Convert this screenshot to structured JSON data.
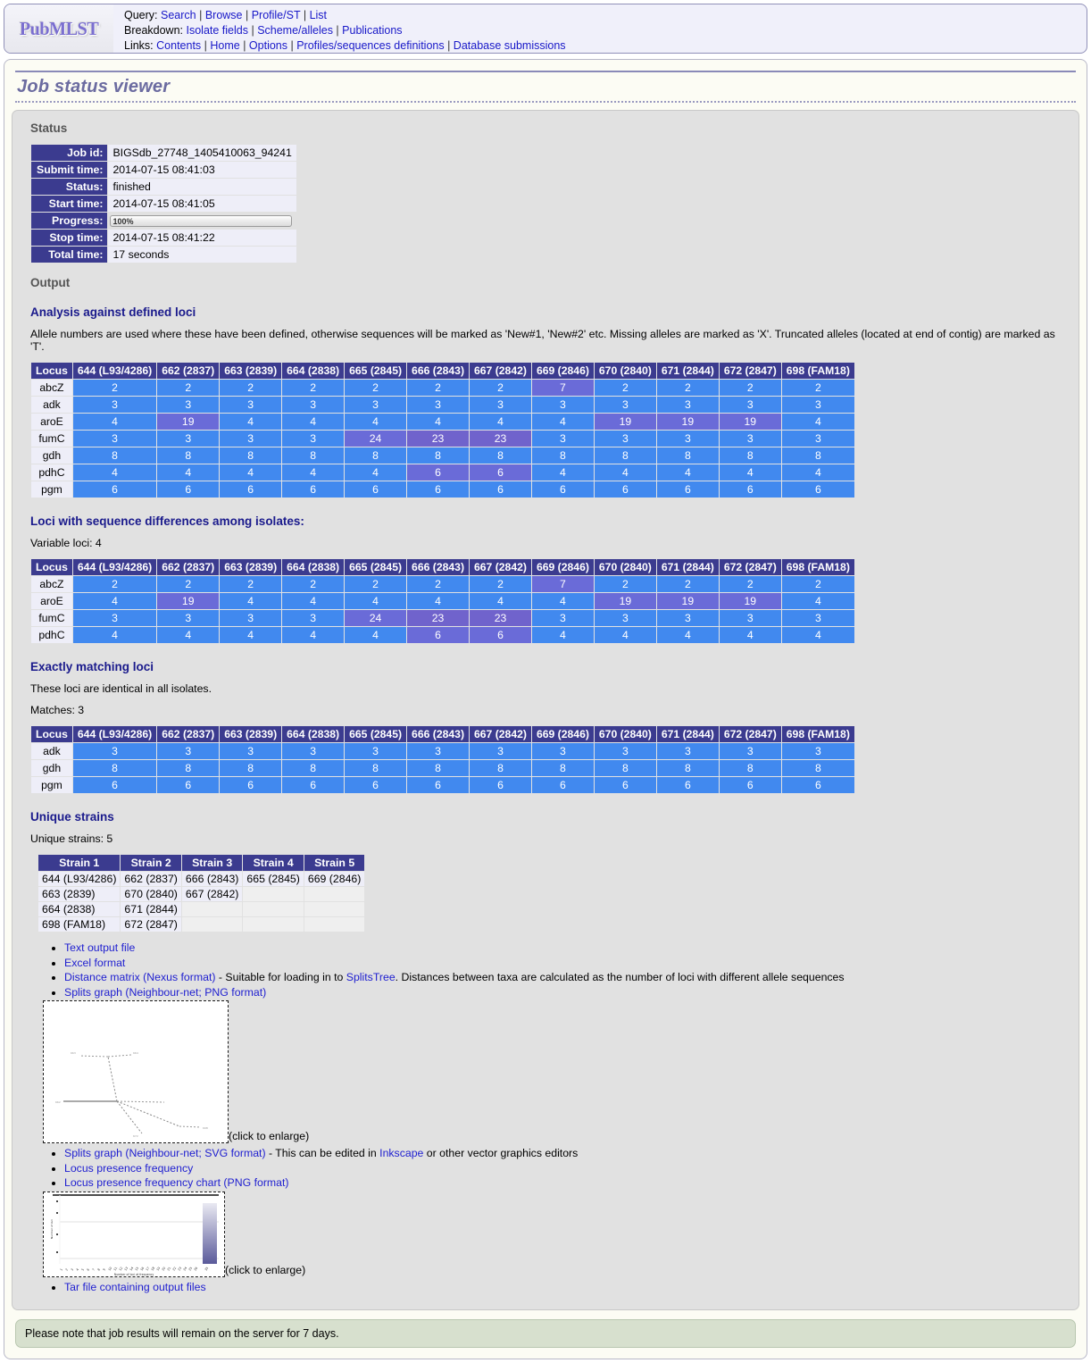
{
  "site": {
    "logo_text": "PubMLST"
  },
  "nav": {
    "rows": [
      {
        "label": "Query:",
        "links": [
          "Search",
          "Browse",
          "Profile/ST",
          "List"
        ]
      },
      {
        "label": "Breakdown:",
        "links": [
          "Isolate fields",
          "Scheme/alleles",
          "Publications"
        ]
      },
      {
        "label": "Links:",
        "links": [
          "Contents",
          "Home",
          "Options",
          "Profiles/sequences definitions",
          "Database submissions"
        ]
      }
    ]
  },
  "page": {
    "title": "Job status viewer"
  },
  "status": {
    "heading": "Status",
    "rows": [
      {
        "label": "Job id:",
        "value": "BIGSdb_27748_1405410063_94241"
      },
      {
        "label": "Submit time:",
        "value": "2014-07-15 08:41:03"
      },
      {
        "label": "Status:",
        "value": "finished"
      },
      {
        "label": "Start time:",
        "value": "2014-07-15 08:41:05"
      },
      {
        "label": "Progress:",
        "value": "100%"
      },
      {
        "label": "Stop time:",
        "value": "2014-07-15 08:41:22"
      },
      {
        "label": "Total time:",
        "value": "17 seconds"
      }
    ],
    "progress_percent": "100%"
  },
  "output": {
    "heading": "Output",
    "defined_loci": {
      "heading": "Analysis against defined loci",
      "description": "Allele numbers are used where these have been defined, otherwise sequences will be marked as 'New#1, 'New#2' etc. Missing alleles are marked as 'X'. Truncated alleles (located at end of contig) are marked as 'T'.",
      "columns": [
        "Locus",
        "644 (L93/4286)",
        "662 (2837)",
        "663 (2839)",
        "664 (2838)",
        "665 (2845)",
        "666 (2843)",
        "667 (2842)",
        "669 (2846)",
        "670 (2840)",
        "671 (2844)",
        "672 (2847)",
        "698 (FAM18)"
      ],
      "rows": [
        {
          "locus": "abcZ",
          "values": [
            "2",
            "2",
            "2",
            "2",
            "2",
            "2",
            "2",
            "7",
            "2",
            "2",
            "2",
            "2"
          ],
          "shades": [
            0,
            0,
            0,
            0,
            0,
            0,
            0,
            1,
            0,
            0,
            0,
            0
          ]
        },
        {
          "locus": "adk",
          "values": [
            "3",
            "3",
            "3",
            "3",
            "3",
            "3",
            "3",
            "3",
            "3",
            "3",
            "3",
            "3"
          ],
          "shades": [
            0,
            0,
            0,
            0,
            0,
            0,
            0,
            0,
            0,
            0,
            0,
            0
          ]
        },
        {
          "locus": "aroE",
          "values": [
            "4",
            "19",
            "4",
            "4",
            "4",
            "4",
            "4",
            "4",
            "19",
            "19",
            "19",
            "4"
          ],
          "shades": [
            0,
            1,
            0,
            0,
            0,
            0,
            0,
            0,
            1,
            1,
            1,
            0
          ]
        },
        {
          "locus": "fumC",
          "values": [
            "3",
            "3",
            "3",
            "3",
            "24",
            "23",
            "23",
            "3",
            "3",
            "3",
            "3",
            "3"
          ],
          "shades": [
            0,
            0,
            0,
            0,
            1,
            2,
            2,
            0,
            0,
            0,
            0,
            0
          ]
        },
        {
          "locus": "gdh",
          "values": [
            "8",
            "8",
            "8",
            "8",
            "8",
            "8",
            "8",
            "8",
            "8",
            "8",
            "8",
            "8"
          ],
          "shades": [
            0,
            0,
            0,
            0,
            0,
            0,
            0,
            0,
            0,
            0,
            0,
            0
          ]
        },
        {
          "locus": "pdhC",
          "values": [
            "4",
            "4",
            "4",
            "4",
            "4",
            "6",
            "6",
            "4",
            "4",
            "4",
            "4",
            "4"
          ],
          "shades": [
            0,
            0,
            0,
            0,
            0,
            1,
            1,
            0,
            0,
            0,
            0,
            0
          ]
        },
        {
          "locus": "pgm",
          "values": [
            "6",
            "6",
            "6",
            "6",
            "6",
            "6",
            "6",
            "6",
            "6",
            "6",
            "6",
            "6"
          ],
          "shades": [
            0,
            0,
            0,
            0,
            0,
            0,
            0,
            0,
            0,
            0,
            0,
            0
          ]
        }
      ]
    },
    "variable_loci": {
      "heading": "Loci with sequence differences among isolates:",
      "count_text": "Variable loci: 4",
      "columns": [
        "Locus",
        "644 (L93/4286)",
        "662 (2837)",
        "663 (2839)",
        "664 (2838)",
        "665 (2845)",
        "666 (2843)",
        "667 (2842)",
        "669 (2846)",
        "670 (2840)",
        "671 (2844)",
        "672 (2847)",
        "698 (FAM18)"
      ],
      "rows": [
        {
          "locus": "abcZ",
          "values": [
            "2",
            "2",
            "2",
            "2",
            "2",
            "2",
            "2",
            "7",
            "2",
            "2",
            "2",
            "2"
          ],
          "shades": [
            0,
            0,
            0,
            0,
            0,
            0,
            0,
            1,
            0,
            0,
            0,
            0
          ]
        },
        {
          "locus": "aroE",
          "values": [
            "4",
            "19",
            "4",
            "4",
            "4",
            "4",
            "4",
            "4",
            "19",
            "19",
            "19",
            "4"
          ],
          "shades": [
            0,
            1,
            0,
            0,
            0,
            0,
            0,
            0,
            1,
            1,
            1,
            0
          ]
        },
        {
          "locus": "fumC",
          "values": [
            "3",
            "3",
            "3",
            "3",
            "24",
            "23",
            "23",
            "3",
            "3",
            "3",
            "3",
            "3"
          ],
          "shades": [
            0,
            0,
            0,
            0,
            1,
            2,
            2,
            0,
            0,
            0,
            0,
            0
          ]
        },
        {
          "locus": "pdhC",
          "values": [
            "4",
            "4",
            "4",
            "4",
            "4",
            "6",
            "6",
            "4",
            "4",
            "4",
            "4",
            "4"
          ],
          "shades": [
            0,
            0,
            0,
            0,
            0,
            1,
            1,
            0,
            0,
            0,
            0,
            0
          ]
        }
      ]
    },
    "matching_loci": {
      "heading": "Exactly matching loci",
      "description": "These loci are identical in all isolates.",
      "count_text": "Matches: 3",
      "columns": [
        "Locus",
        "644 (L93/4286)",
        "662 (2837)",
        "663 (2839)",
        "664 (2838)",
        "665 (2845)",
        "666 (2843)",
        "667 (2842)",
        "669 (2846)",
        "670 (2840)",
        "671 (2844)",
        "672 (2847)",
        "698 (FAM18)"
      ],
      "rows": [
        {
          "locus": "adk",
          "values": [
            "3",
            "3",
            "3",
            "3",
            "3",
            "3",
            "3",
            "3",
            "3",
            "3",
            "3",
            "3"
          ],
          "shades": [
            0,
            0,
            0,
            0,
            0,
            0,
            0,
            0,
            0,
            0,
            0,
            0
          ]
        },
        {
          "locus": "gdh",
          "values": [
            "8",
            "8",
            "8",
            "8",
            "8",
            "8",
            "8",
            "8",
            "8",
            "8",
            "8",
            "8"
          ],
          "shades": [
            0,
            0,
            0,
            0,
            0,
            0,
            0,
            0,
            0,
            0,
            0,
            0
          ]
        },
        {
          "locus": "pgm",
          "values": [
            "6",
            "6",
            "6",
            "6",
            "6",
            "6",
            "6",
            "6",
            "6",
            "6",
            "6",
            "6"
          ],
          "shades": [
            0,
            0,
            0,
            0,
            0,
            0,
            0,
            0,
            0,
            0,
            0,
            0
          ]
        }
      ]
    },
    "unique_strains": {
      "heading": "Unique strains",
      "count_text": "Unique strains: 5",
      "columns": [
        "Strain 1",
        "Strain 2",
        "Strain 3",
        "Strain 4",
        "Strain 5"
      ],
      "rows": [
        [
          "644 (L93/4286)",
          "662 (2837)",
          "666 (2843)",
          "665 (2845)",
          "669 (2846)"
        ],
        [
          "663 (2839)",
          "670 (2840)",
          "667 (2842)",
          "",
          ""
        ],
        [
          "664 (2838)",
          "671 (2844)",
          "",
          "",
          ""
        ],
        [
          "698 (FAM18)",
          "672 (2847)",
          "",
          "",
          ""
        ]
      ]
    },
    "links": {
      "text_output": "Text output file",
      "excel": "Excel format",
      "distance_matrix": "Distance matrix (Nexus format)",
      "distance_matrix_tail_1": " - Suitable for loading in to ",
      "splitstree": "SplitsTree",
      "distance_matrix_tail_2": ". Distances between taxa are calculated as the number of loci with different allele sequences",
      "splits_png": "Splits graph (Neighbour-net; PNG format)",
      "splits_svg": "Splits graph (Neighbour-net; SVG format)",
      "splits_svg_tail_1": " - This can be edited in ",
      "inkscape": "Inkscape",
      "splits_svg_tail_2": " or other vector graphics editors",
      "locus_presence": "Locus presence frequency",
      "locus_presence_chart": "Locus presence frequency chart (PNG format)",
      "tar_file": "Tar file containing output files",
      "click_to_enlarge": "(click to enlarge)"
    }
  },
  "chart_data": {
    "type": "bar",
    "title": "",
    "xlabel": "Number of loci at frequency",
    "ylabel": "Number of loci",
    "categories": [
      "1",
      "2",
      "3",
      "4",
      "5",
      "6",
      "7",
      "8",
      "9",
      "10",
      "11",
      "12",
      "13",
      "14",
      "15",
      "16",
      "17",
      "18",
      "19",
      "20",
      "21",
      "22",
      "23",
      "24",
      "25",
      "26",
      "27",
      "28",
      "29",
      "30",
      "31",
      "32",
      "33",
      "34",
      "35"
    ],
    "values": [
      0,
      0,
      0,
      0,
      0,
      0,
      0,
      0,
      0,
      0,
      0,
      0,
      0,
      0,
      0,
      0,
      0,
      0,
      0,
      0,
      0,
      0,
      0,
      0,
      0,
      0,
      0,
      0,
      0,
      0,
      0,
      0,
      0,
      0,
      7
    ],
    "ylim": [
      0,
      8
    ],
    "grid": true,
    "legend": "none",
    "bar_color_top": "#e6e6ef",
    "bar_color_bottom": "#5a5a9a"
  },
  "footer": {
    "note": "Please note that job results will remain on the server for 7 days."
  }
}
